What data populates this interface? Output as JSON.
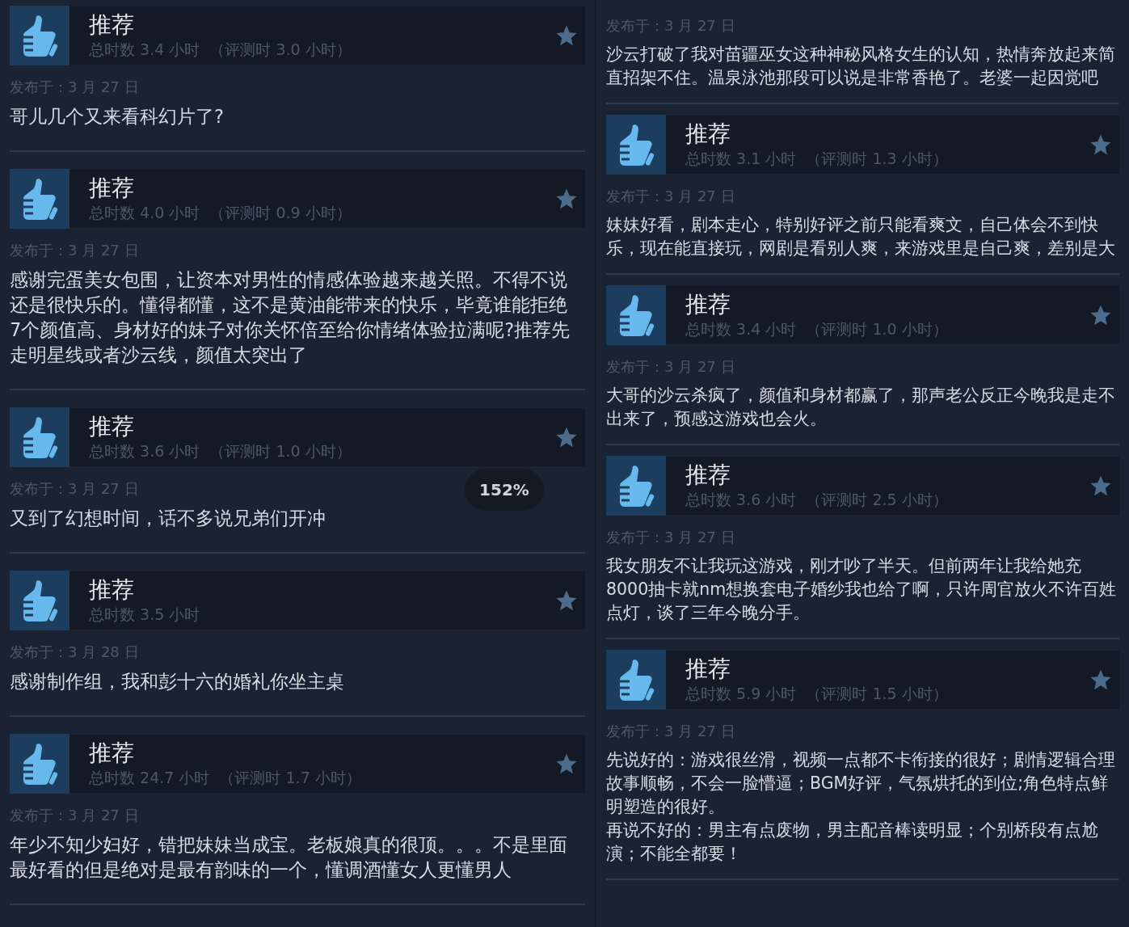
{
  "columns": [
    {
      "reviews": [
        {
          "title": "推荐",
          "hours": "总时数 3.4 小时  （评测时 3.0 小时）",
          "date": "发布于：3 月 27 日",
          "body": [
            "哥儿几个又来看科幻片了?"
          ]
        },
        {
          "title": "推荐",
          "hours": "总时数 4.0 小时  （评测时 0.9 小时）",
          "date": "发布于：3 月 27 日",
          "body": [
            "感谢完蛋美女包围，让资本对男性的情感体验越来越关照。不得不说",
            "还是很快乐的。懂得都懂，这不是黄油能带来的快乐，毕竟谁能拒绝",
            "7个颜值高、身材好的妹子对你关怀倍至给你情绪体验拉满呢?推荐先",
            "走明星线或者沙云线，颜值太突出了"
          ]
        },
        {
          "title": "推荐",
          "hours": "总时数 3.6 小时  （评测时 1.0 小时）",
          "date": "发布于：3 月 27 日",
          "body": [
            "又到了幻想时间，话不多说兄弟们开冲"
          ]
        },
        {
          "title": "推荐",
          "hours": "总时数 3.5 小时",
          "date": "发布于：3 月 28 日",
          "body": [
            "感谢制作组，我和彭十六的婚礼你坐主桌"
          ]
        },
        {
          "title": "推荐",
          "hours": "总时数 24.7 小时  （评测时 1.7 小时）",
          "date": "发布于：3 月 27 日",
          "body": [
            "年少不知少妇好，错把妹妹当成宝。老板娘真的很顶。。。不是里面",
            "最好看的但是绝对是最有韵味的一个，懂调酒懂女人更懂男人"
          ]
        }
      ]
    },
    {
      "reviews": [
        {
          "date": "发布于：3 月 27 日",
          "body": [
            "沙云打破了我对苗疆巫女这种神秘风格女生的认知，热情奔放起来简",
            "直招架不住。温泉泳池那段可以说是非常香艳了。老婆一起因觉吧"
          ]
        },
        {
          "title": "推荐",
          "hours": "总时数 3.1 小时  （评测时 1.3 小时）",
          "date": "发布于：3 月 27 日",
          "body": [
            "妹妹好看，剧本走心，特别好评之前只能看爽文，自己体会不到快",
            "乐，现在能直接玩，网剧是看别人爽，来游戏里是自己爽，差别是大"
          ]
        },
        {
          "title": "推荐",
          "hours": "总时数 3.4 小时  （评测时 1.0 小时）",
          "date": "发布于：3 月 27 日",
          "body": [
            "大哥的沙云杀疯了，颜值和身材都赢了，那声老公反正今晚我是走不",
            "出来了，预感这游戏也会火。"
          ]
        },
        {
          "title": "推荐",
          "hours": "总时数 3.6 小时  （评测时 2.5 小时）",
          "date": "发布于：3 月 27 日",
          "body": [
            "我女朋友不让我玩这游戏，刚才吵了半天。但前两年让我给她充",
            "8000抽卡就nm想换套电子婚纱我也给了啊，只许周官放火不许百姓",
            "点灯，谈了三年今晚分手。"
          ]
        },
        {
          "title": "推荐",
          "hours": "总时数 5.9 小时  （评测时 1.5 小时）",
          "date": "发布于：3 月 27 日",
          "body": [
            "先说好的：游戏很丝滑，视频一点都不卡衔接的很好；剧情逻辑合理",
            "故事顺畅，不会一脸懵逼；BGM好评，气氛烘托的到位;角色特点鲜",
            "明塑造的很好。",
            "再说不好的：男主有点废物，男主配音棒读明显；个别桥段有点尬",
            "演；不能全都要！"
          ]
        }
      ]
    }
  ],
  "zoom_badge": "152%"
}
